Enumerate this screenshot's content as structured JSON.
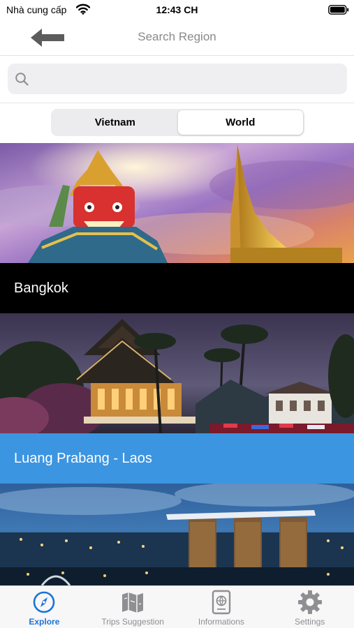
{
  "status_bar": {
    "carrier": "Nhà cung cấp",
    "time": "12:43 CH",
    "icons": [
      "wifi-icon",
      "battery-icon"
    ]
  },
  "nav": {
    "title": "Search Region",
    "back_icon": "arrow-left-icon"
  },
  "search": {
    "placeholder": "",
    "value": "",
    "icon": "search-icon"
  },
  "segments": {
    "items": [
      {
        "label": "Vietnam",
        "selected": false
      },
      {
        "label": "World",
        "selected": true
      }
    ]
  },
  "regions": [
    {
      "name": "Bangkok",
      "bar_color": "#000000",
      "image": "bangkok-temple-photo"
    },
    {
      "name": "Luang Prabang - Laos",
      "bar_color": "#3c95e0",
      "image": "luang-prabang-temple-photo"
    },
    {
      "name": "",
      "bar_color": "",
      "image": "singapore-marina-bay-photo"
    }
  ],
  "tabs": [
    {
      "label": "Explore",
      "icon": "compass-icon",
      "active": true
    },
    {
      "label": "Trips Suggestion",
      "icon": "map-icon",
      "active": false
    },
    {
      "label": "Informations",
      "icon": "passport-icon",
      "active": false
    },
    {
      "label": "Settings",
      "icon": "gear-icon",
      "active": false
    }
  ],
  "colors": {
    "accent": "#1a73d9",
    "tab_inactive": "#8e8e93",
    "luang_prabang_bar": "#3c95e0"
  }
}
